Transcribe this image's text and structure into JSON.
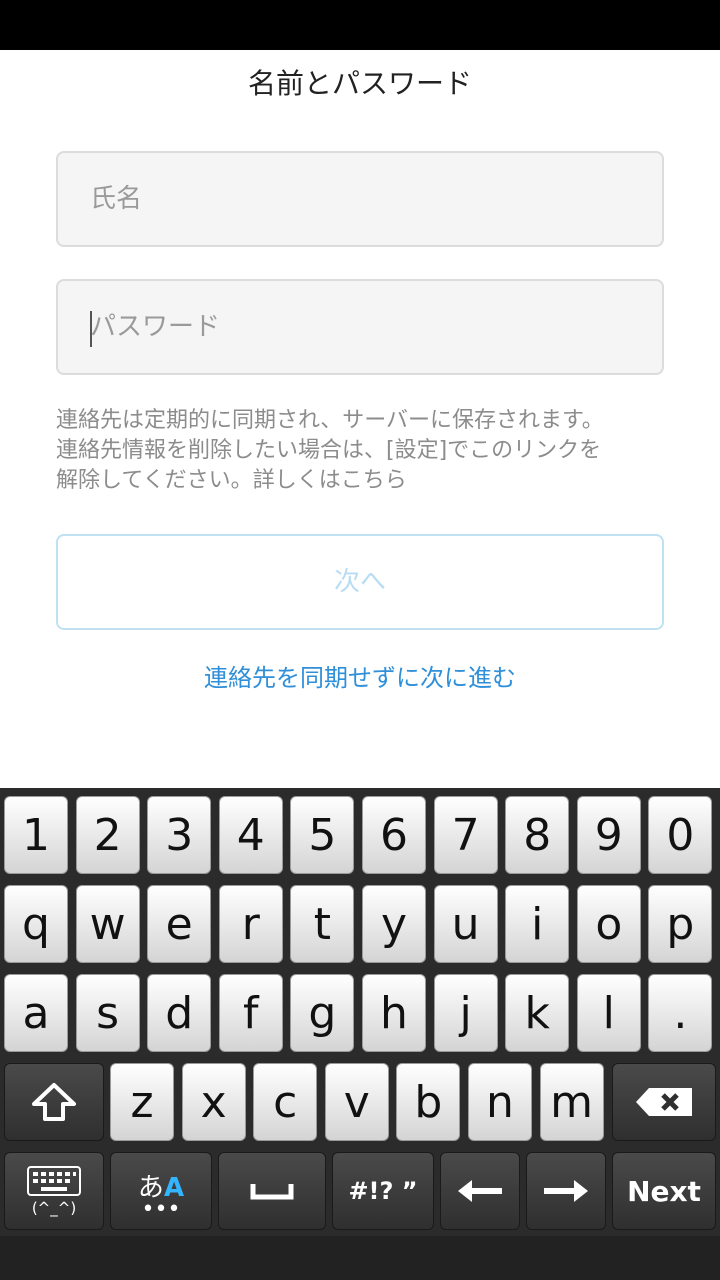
{
  "header": {
    "title": "名前とパスワード"
  },
  "form": {
    "name_placeholder": "氏名",
    "password_placeholder": "パスワード",
    "notice_line1": "連絡先は定期的に同期され、サーバーに保存されます。",
    "notice_line2": "連絡先情報を削除したい場合は、[設定]でこのリンクを",
    "notice_line3": "解除してください。",
    "notice_link": "詳しくはこちら",
    "next_label": "次へ",
    "skip_label": "連絡先を同期せずに次に進む"
  },
  "keyboard": {
    "rows": [
      [
        "1",
        "2",
        "3",
        "4",
        "5",
        "6",
        "7",
        "8",
        "9",
        "0"
      ],
      [
        "q",
        "w",
        "e",
        "r",
        "t",
        "y",
        "u",
        "i",
        "o",
        "p"
      ],
      [
        "a",
        "s",
        "d",
        "f",
        "g",
        "h",
        "j",
        "k",
        "l",
        "."
      ],
      [
        "z",
        "x",
        "c",
        "v",
        "b",
        "n",
        "m"
      ]
    ],
    "emoticon_label": "(^_^)",
    "kana_label": "あ",
    "alpha_label": "A",
    "symbols_label": "#!? ”",
    "next_key_label": "Next",
    "icons": {
      "shift": "shift-arrow-icon",
      "backspace": "backspace-icon",
      "keyboard": "keyboard-icon",
      "space": "space-bar-icon",
      "left": "left-arrow-icon",
      "right": "right-arrow-icon"
    },
    "colors": {
      "accent": "#33b5ff"
    }
  }
}
